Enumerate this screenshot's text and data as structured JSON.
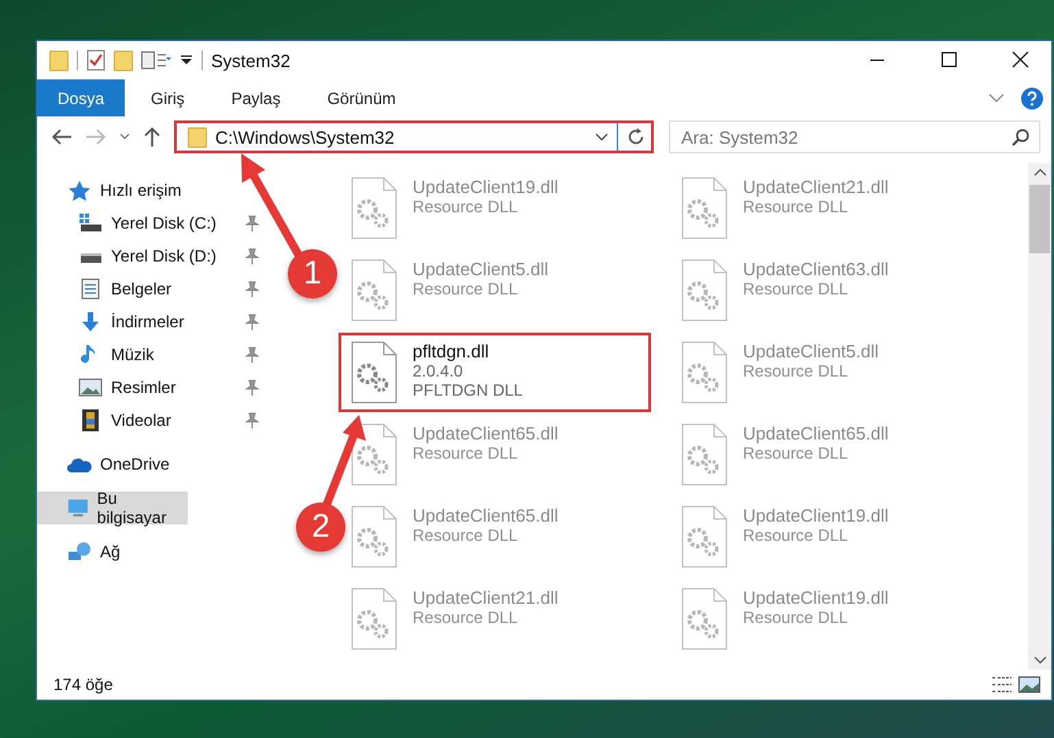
{
  "window": {
    "title": "System32"
  },
  "ribbon_tabs": [
    {
      "label": "Dosya",
      "selected": true
    },
    {
      "label": "Giriş",
      "selected": false
    },
    {
      "label": "Paylaş",
      "selected": false
    },
    {
      "label": "Görünüm",
      "selected": false
    }
  ],
  "address_bar": {
    "path": "C:\\Windows\\System32",
    "highlighted": true
  },
  "search": {
    "placeholder": "Ara: System32"
  },
  "sidebar": {
    "items": [
      {
        "label": "Hızlı erişim",
        "kind": "star",
        "selected": false,
        "children": [
          {
            "label": "Yerel Disk (C:)",
            "kind": "drive-win",
            "pinned": true,
            "selected": false
          },
          {
            "label": "Yerel Disk (D:)",
            "kind": "drive",
            "pinned": true,
            "selected": false
          },
          {
            "label": "Belgeler",
            "kind": "docs",
            "pinned": true,
            "selected": false
          },
          {
            "label": "İndirmeler",
            "kind": "download",
            "pinned": true,
            "selected": false
          },
          {
            "label": "Müzik",
            "kind": "music",
            "pinned": true,
            "selected": false
          },
          {
            "label": "Resimler",
            "kind": "pictures",
            "pinned": true,
            "selected": false
          },
          {
            "label": "Videolar",
            "kind": "videos",
            "pinned": true,
            "selected": false
          }
        ]
      },
      {
        "label": "OneDrive",
        "kind": "cloud",
        "selected": false
      },
      {
        "label": "Bu bilgisayar",
        "kind": "computer",
        "selected": true
      },
      {
        "label": "Ağ",
        "kind": "network",
        "selected": false
      }
    ]
  },
  "files": [
    {
      "name": "UpdateClient19.dll",
      "description": "Resource DLL",
      "blurred": true,
      "highlighted": false
    },
    {
      "name": "UpdateClient21.dll",
      "description": "Resource DLL",
      "blurred": true,
      "highlighted": false
    },
    {
      "name": "UpdateClient5.dll",
      "description": "Resource DLL",
      "blurred": true,
      "highlighted": false
    },
    {
      "name": "UpdateClient63.dll",
      "description": "Resource DLL",
      "blurred": true,
      "highlighted": false
    },
    {
      "name": "pfltdgn.dll",
      "version": "2.0.4.0",
      "description": "PFLTDGN DLL",
      "blurred": false,
      "highlighted": true
    },
    {
      "name": "UpdateClient5.dll",
      "description": "Resource DLL",
      "blurred": true,
      "highlighted": false
    },
    {
      "name": "UpdateClient65.dll",
      "description": "Resource DLL",
      "blurred": true,
      "highlighted": false
    },
    {
      "name": "UpdateClient65.dll",
      "description": "Resource DLL",
      "blurred": true,
      "highlighted": false
    },
    {
      "name": "UpdateClient65.dll",
      "description": "Resource DLL",
      "blurred": true,
      "highlighted": false
    },
    {
      "name": "UpdateClient19.dll",
      "description": "Resource DLL",
      "blurred": true,
      "highlighted": false
    },
    {
      "name": "UpdateClient21.dll",
      "description": "Resource DLL",
      "blurred": true,
      "highlighted": false
    },
    {
      "name": "UpdateClient19.dll",
      "description": "Resource DLL",
      "blurred": true,
      "highlighted": false
    }
  ],
  "annotations": [
    {
      "label": "1"
    },
    {
      "label": "2"
    }
  ],
  "status_bar": {
    "item_count": "174 öğe"
  }
}
